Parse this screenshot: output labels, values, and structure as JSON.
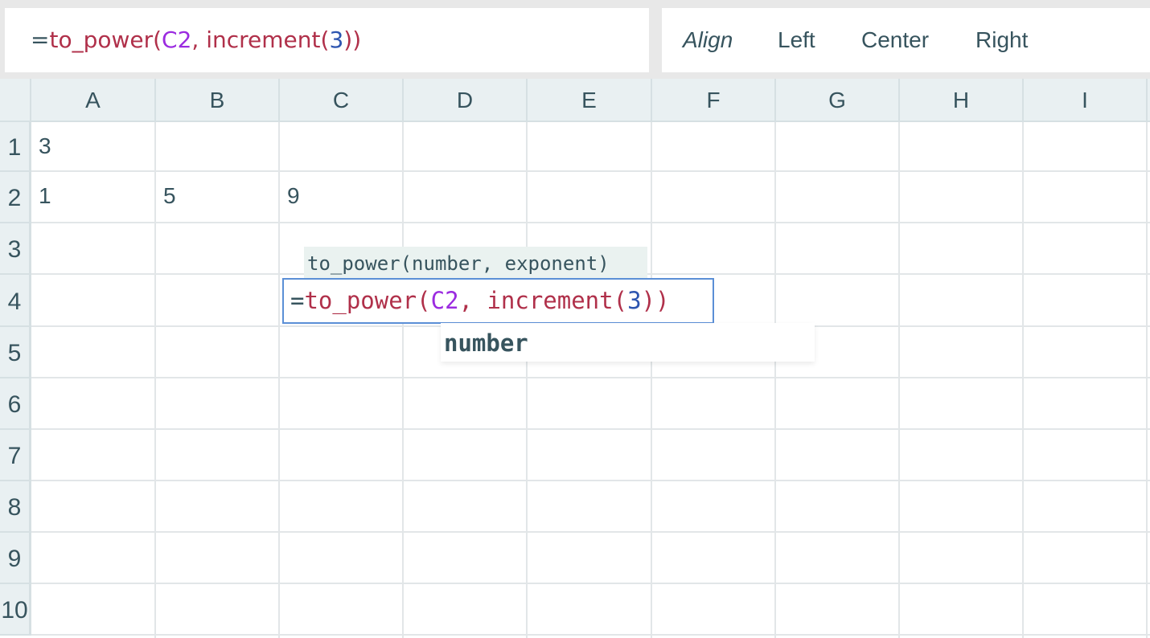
{
  "formula_bar": {
    "eq": "=",
    "fn": "to_power(",
    "ref": "C2",
    "sep": ", ",
    "fn2": "increment(",
    "num": "3",
    "close": "))"
  },
  "align_bar": {
    "label": "Align",
    "left": "Left",
    "center": "Center",
    "right": "Right"
  },
  "columns": [
    "A",
    "B",
    "C",
    "D",
    "E",
    "F",
    "G",
    "H",
    "I"
  ],
  "rows": [
    "1",
    "2",
    "3",
    "4",
    "5",
    "6",
    "7",
    "8",
    "9",
    "10"
  ],
  "cells": {
    "A1": "3",
    "A2": "1",
    "B2": "5",
    "C2": "9"
  },
  "editor": {
    "signature": "to_power(number, exponent)",
    "eq": "=",
    "fn": "to_power(",
    "ref": "C2",
    "sep": ", ",
    "fn2": "increment(",
    "num": "3",
    "close": "))",
    "hint": "number"
  },
  "colors": {
    "function": "#b0304a",
    "reference": "#9b2be0",
    "number": "#2d55b0",
    "editor_border": "#5b8fd6",
    "header_bg": "#e9f0f2"
  }
}
